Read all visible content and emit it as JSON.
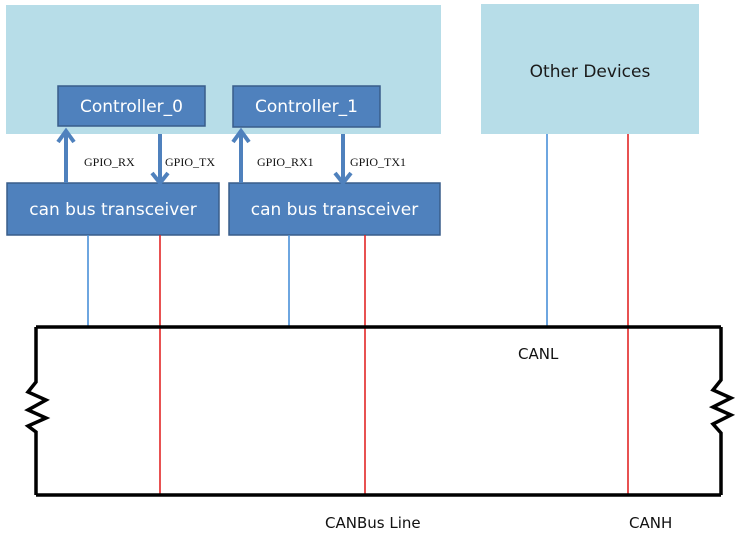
{
  "colors": {
    "panel_fill": "#b7dde8",
    "box_fill": "#4f81bd",
    "box_stroke": "#385d8a",
    "arrow": "#4f81bd",
    "canl_wire": "#4a90d9",
    "canh_wire": "#e32626",
    "bus_wire": "#000000"
  },
  "host_panel": {
    "label": ""
  },
  "controllers": [
    {
      "label": "Controller_0"
    },
    {
      "label": "Controller_1"
    }
  ],
  "transceivers": [
    {
      "label": "can bus transceiver"
    },
    {
      "label": "can bus transceiver"
    }
  ],
  "signals": [
    {
      "label": "GPIO_RX",
      "direction": "up"
    },
    {
      "label": "GPIO_TX",
      "direction": "down"
    },
    {
      "label": "GPIO_RX1",
      "direction": "up"
    },
    {
      "label": "GPIO_TX1",
      "direction": "down"
    }
  ],
  "other_devices": {
    "label": "Other Devices"
  },
  "bus": {
    "canl_label": "CANL",
    "canh_label": "CANH",
    "line_label": "CANBus Line"
  }
}
